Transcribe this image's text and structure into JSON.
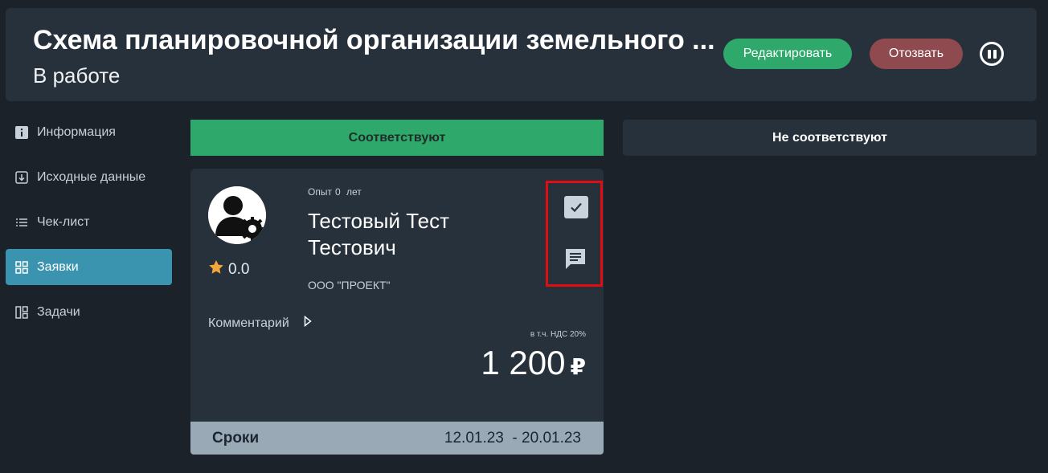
{
  "header": {
    "title": "Схема планировочной организации земельного ...",
    "status": "В работе",
    "edit_label": "Редактировать",
    "recall_label": "Отозвать",
    "colors": {
      "edit": "#2fa96b",
      "recall": "#8e4a4f"
    }
  },
  "sidebar": {
    "items": [
      {
        "label": "Информация",
        "icon": "info-icon"
      },
      {
        "label": "Исходные данные",
        "icon": "download-icon"
      },
      {
        "label": "Чек-лист",
        "icon": "checklist-icon"
      },
      {
        "label": "Заявки",
        "icon": "grid-icon",
        "active": true
      },
      {
        "label": "Задачи",
        "icon": "board-icon"
      }
    ],
    "active_color": "#3a94b0"
  },
  "columns": {
    "ok": "Соответствуют",
    "not_ok": "Не соответствуют"
  },
  "card": {
    "rating": "0.0",
    "experience_prefix": "Опыт",
    "experience_value": "0",
    "experience_unit": "лет",
    "name": "Тестовый Тест Тестович",
    "organization": "ООО \"ПРОЕКТ\"",
    "comment_label": "Комментарий",
    "vat_note": "в т.ч. НДС 20%",
    "price": "1 200",
    "currency": "₽",
    "terms_label": "Сроки",
    "terms_value": "12.01.23  - 20.01.23"
  }
}
